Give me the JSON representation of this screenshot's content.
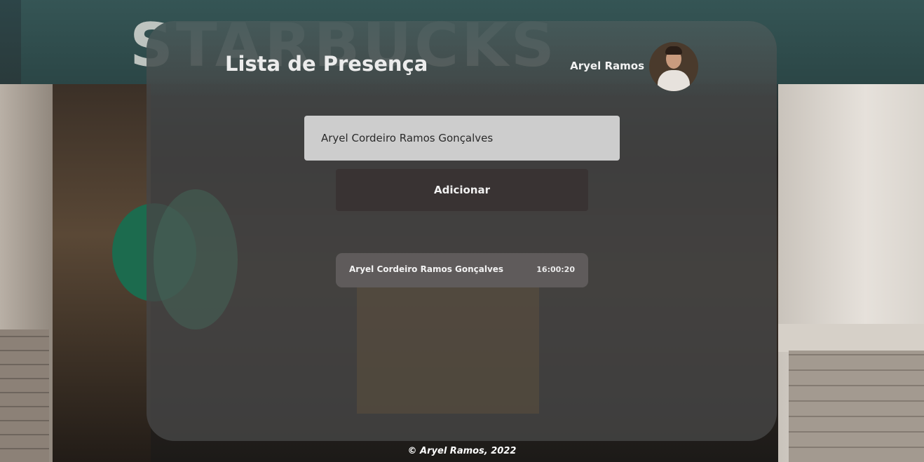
{
  "header": {
    "title": "Lista de Presença",
    "user_name": "Aryel Ramos"
  },
  "form": {
    "input_value": "Aryel Cordeiro Ramos Gonçalves",
    "add_label": "Adicionar"
  },
  "attendees": [
    {
      "name": "Aryel Cordeiro Ramos Gonçalves",
      "time": "16:00:20"
    }
  ],
  "footer": {
    "text": "© Aryel Ramos, 2022"
  },
  "colors": {
    "input_bg": "#cdcdcd",
    "button_bg": "#393333",
    "card_bg": "#5f5b5b",
    "panel_bg": "#464646"
  },
  "icons": {
    "avatar": "user-photo"
  }
}
